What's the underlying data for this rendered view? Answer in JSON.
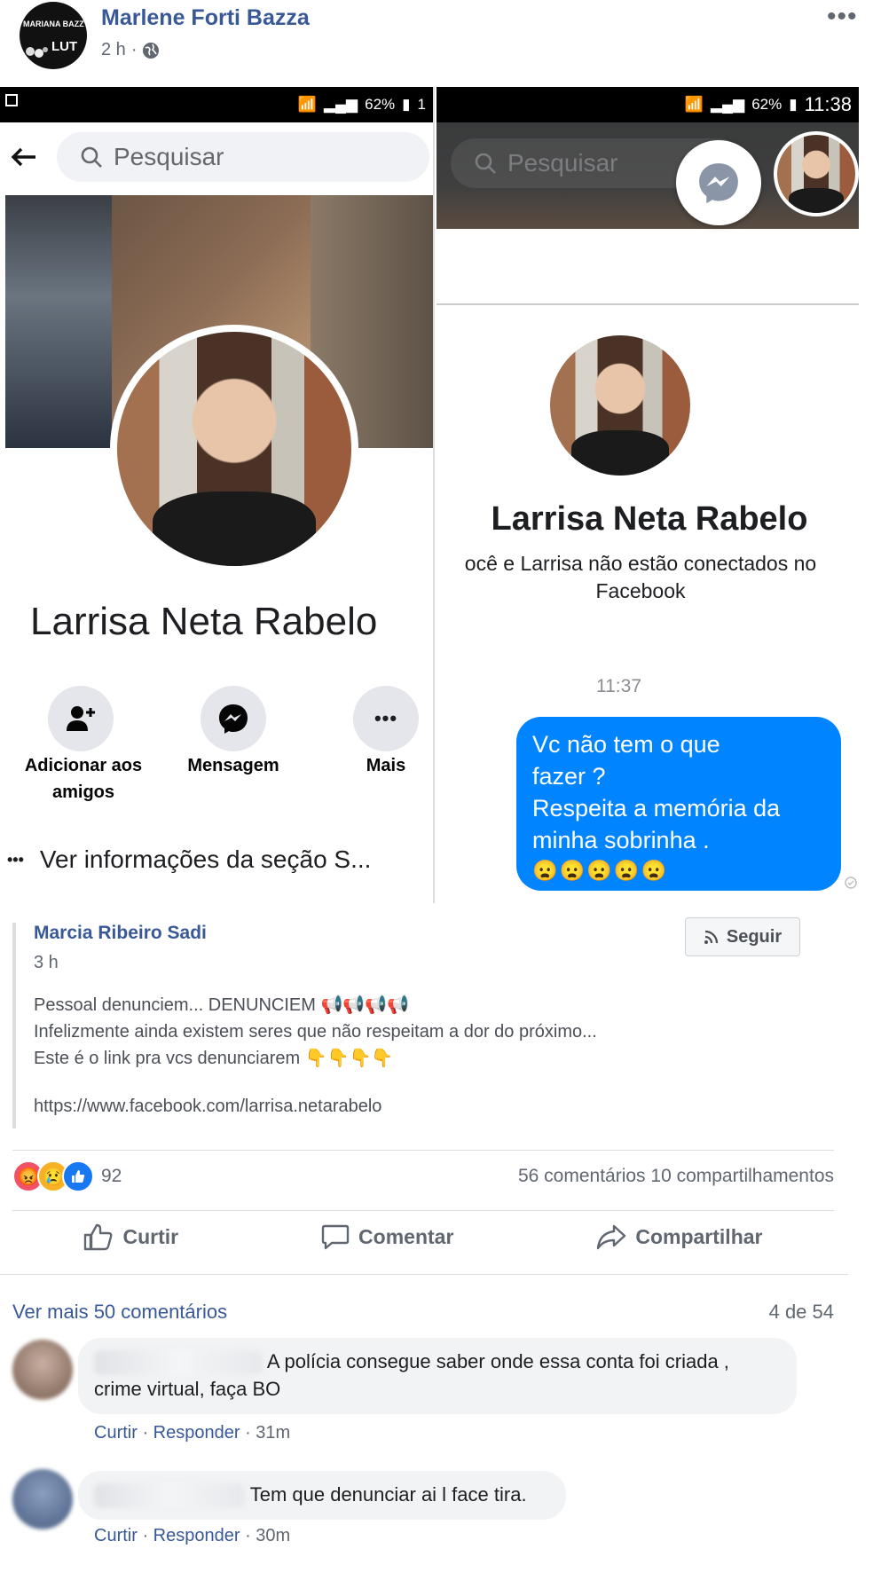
{
  "post": {
    "author": "Marlene Forti Bazza",
    "time": "2 h",
    "avatar_text1": "MARIANA BAZZ",
    "avatar_text2": "LUT",
    "privacy_icon": "globe-icon",
    "more_icon": "more-horizontal-icon"
  },
  "left_screenshot": {
    "battery": "62%",
    "time_fragment": "1",
    "search_placeholder": "Pesquisar",
    "profile_name": "Larrisa Neta Rabelo",
    "actions": [
      {
        "label_line1": "Adicionar aos",
        "label_line2": "amigos",
        "icon": "add-friend-icon"
      },
      {
        "label_line1": "Mensagem",
        "label_line2": "",
        "icon": "messenger-icon"
      },
      {
        "label_line1": "Mais",
        "label_line2": "",
        "icon": "more-horizontal-icon"
      }
    ],
    "see_info": "Ver informações da seção S..."
  },
  "right_screenshot": {
    "battery": "62%",
    "time": "11:38",
    "search_placeholder": "Pesquisar",
    "profile_name": "Larrisa Neta Rabelo",
    "not_connected_line1": "ocê e Larrisa não estão conectados no",
    "not_connected_line2": "Facebook",
    "message_time": "11:37",
    "message_line1": "Vc não tem o que",
    "message_line2": "fazer ?",
    "message_line3": "Respeita a memória da",
    "message_line4": "minha sobrinha .",
    "message_emojis": "😦😦😦😦😦"
  },
  "shared": {
    "author": "Marcia Ribeiro Sadi",
    "time": "3 h",
    "follow_label": "Seguir",
    "line1": "Pessoal denunciem... DENUNCIEM 📢📢📢📢",
    "line2": "Infelizmente ainda existem seres que não respeitam a dor do próximo...",
    "line3": "Este é o link pra vcs denunciarem 👇👇👇👇",
    "link": "https://www.facebook.com/larrisa.netarabelo"
  },
  "stats": {
    "reaction_count": "92",
    "comments": "56 comentários",
    "shares": "10 compartilhamentos",
    "reaction_icons": [
      "angry-icon",
      "sad-icon",
      "like-icon"
    ]
  },
  "actions": {
    "like": "Curtir",
    "comment": "Comentar",
    "share": "Compartilhar"
  },
  "comments_section": {
    "more": "Ver mais 50 comentários",
    "page": "4 de 54",
    "items": [
      {
        "text_line1": "A polícia consegue saber onde essa conta foi criada ,",
        "text_line2": "crime virtual, faça BO",
        "like": "Curtir",
        "reply": "Responder",
        "time": "31m"
      },
      {
        "text_line1": "Tem que denunciar ai l face tira.",
        "text_line2": "",
        "like": "Curtir",
        "reply": "Responder",
        "time": "30m"
      }
    ]
  }
}
